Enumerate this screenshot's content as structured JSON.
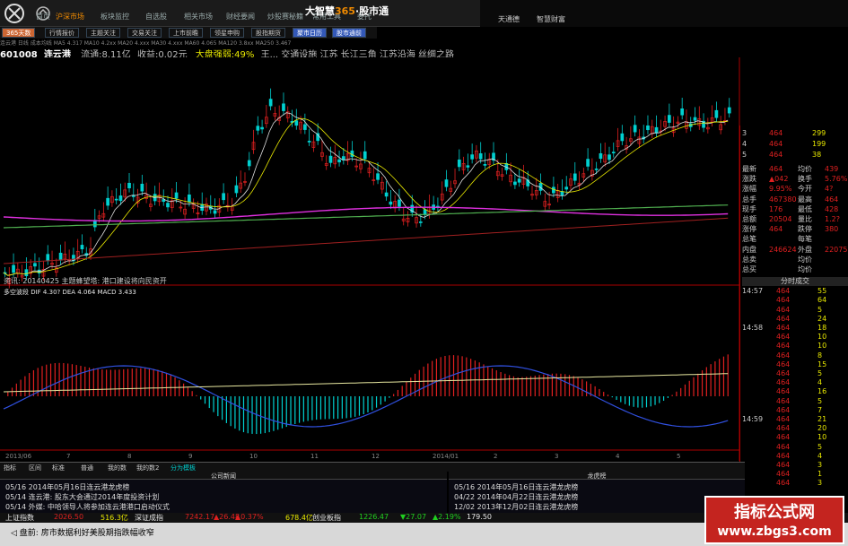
{
  "app": {
    "brand_main": "大智慧",
    "brand_num": "365",
    "brand_sep": "·",
    "brand_sub": "股市通"
  },
  "nav": [
    {
      "label": "首页"
    },
    {
      "label": "沪深市场"
    },
    {
      "label": "板块监控"
    },
    {
      "label": "自选股"
    },
    {
      "label": "相关市场"
    },
    {
      "label": "财经要闻"
    },
    {
      "label": "炒股赛秘籍"
    },
    {
      "label": "常用工具"
    },
    {
      "label": "委托"
    }
  ],
  "right_nav": [
    {
      "label": "天通德"
    },
    {
      "label": "智慧财富"
    }
  ],
  "toolbar": [
    {
      "label": "365天数"
    },
    {
      "label": "行情报价"
    },
    {
      "label": "主题关注"
    },
    {
      "label": "交易关注"
    },
    {
      "label": "上市前瞻"
    },
    {
      "label": "领星申购"
    },
    {
      "label": "股指期货"
    },
    {
      "label": "聚市日历"
    },
    {
      "label": "股市通前"
    }
  ],
  "stock": {
    "code": "601008",
    "name": "连云港",
    "stock_line": "连云港   日线   成本均线   MA5 4.317   MA10 4.2xx   MA20 4.xxx   MA30 4.xxx   MA60 4.065   MA120 3.8xx   MA250 3.467",
    "circ_label": "流通:",
    "circ": "8.11亿",
    "gain_label": "收益",
    "gain": "0.02元",
    "mkt": "大盘强弱:49%",
    "region": "王... 交通设施  江苏  长江三角  江苏沿海  丝绸之路"
  },
  "info_line": "资讯:   20140425  主题蜂望塔: 港口建设将向民资开",
  "macd_line": "多空波段   DIF 4.30?  DEA 4.064  MACD 3.433",
  "dates": [
    "2013/06",
    "7",
    "8",
    "9",
    "10",
    "11",
    "12",
    "2014/01",
    "2",
    "3",
    "4",
    "5"
  ],
  "chart_data": {
    "type": "line",
    "title": "601008 连云港",
    "series": [
      {
        "name": "MA250"
      }
    ],
    "ylim": [
      3.3,
      5.4
    ]
  },
  "order_book": [
    {
      "level": "3",
      "price": "464",
      "vol": "299"
    },
    {
      "level": "4",
      "price": "464",
      "vol": "199"
    },
    {
      "level": "5",
      "price": "464",
      "vol": "38"
    }
  ],
  "quote": [
    {
      "l1": "最新",
      "v1": "464",
      "l2": "均价",
      "v2": "439"
    },
    {
      "l1": "涨跌",
      "v1": "▲042",
      "l2": "换手",
      "v2": "5.76%"
    },
    {
      "l1": "涨幅",
      "v1": "9.95%",
      "l2": "今开",
      "v2": "4?"
    },
    {
      "l1": "总手",
      "v1": "467380",
      "l2": "最高",
      "v2": "464"
    },
    {
      "l1": "现手",
      "v1": "176",
      "l2": "最低",
      "v2": "428"
    },
    {
      "l1": "总额",
      "v1": "20504",
      "l2": "量比",
      "v2": "1.2?"
    },
    {
      "l1": "涨停",
      "v1": "464",
      "l2": "跌停",
      "v2": "380"
    },
    {
      "l1": "总笔",
      "v1": "",
      "l2": "每笔",
      "v2": ""
    },
    {
      "l1": "内盘",
      "v1": "246624",
      "l2": "外盘",
      "v2": "220756"
    },
    {
      "l1": "总卖",
      "v1": "",
      "l2": "均价",
      "v2": ""
    },
    {
      "l1": "总买",
      "v1": "",
      "l2": "均价",
      "v2": ""
    }
  ],
  "trades_header": "分时成交",
  "trades": [
    {
      "t": "14:57",
      "p": "464",
      "v": "55"
    },
    {
      "t": "",
      "p": "464",
      "v": "64"
    },
    {
      "t": "",
      "p": "464",
      "v": "5"
    },
    {
      "t": "",
      "p": "464",
      "v": "24"
    },
    {
      "t": "14:58",
      "p": "464",
      "v": "18"
    },
    {
      "t": "",
      "p": "464",
      "v": "10"
    },
    {
      "t": "",
      "p": "464",
      "v": "10"
    },
    {
      "t": "",
      "p": "464",
      "v": "8"
    },
    {
      "t": "",
      "p": "464",
      "v": "15"
    },
    {
      "t": "",
      "p": "464",
      "v": "5"
    },
    {
      "t": "",
      "p": "464",
      "v": "4"
    },
    {
      "t": "",
      "p": "464",
      "v": "16"
    },
    {
      "t": "",
      "p": "464",
      "v": "5"
    },
    {
      "t": "",
      "p": "464",
      "v": "7"
    },
    {
      "t": "14:59",
      "p": "464",
      "v": "21"
    },
    {
      "t": "",
      "p": "464",
      "v": "20"
    },
    {
      "t": "",
      "p": "464",
      "v": "10"
    },
    {
      "t": "",
      "p": "464",
      "v": "5"
    },
    {
      "t": "",
      "p": "464",
      "v": "4"
    },
    {
      "t": "",
      "p": "464",
      "v": "3"
    },
    {
      "t": "",
      "p": "464",
      "v": "1"
    },
    {
      "t": "",
      "p": "464",
      "v": "3"
    }
  ],
  "bottom_tabs": [
    "指标",
    "区间",
    "标准",
    "普通",
    "我的数",
    "我的数2",
    "我的数",
    "分为模板"
  ],
  "news": {
    "left_header": "公司新闻",
    "left": [
      "05/16  2014年05月16日连云港龙虎榜",
      "05/14  连云港: 股东大会通过2014年度投资计划",
      "05/14  外媒: 中哈领导人将参加连云港港口启动仪式"
    ],
    "right_header": "龙虎榜",
    "right": [
      "05/16  2014年05月16日连云港龙虎榜",
      "04/22  2014年04月22日连云港龙虎榜",
      "12/02  2013年12月02日连云港龙虎榜"
    ]
  },
  "ticker": [
    {
      "text": "上证指数",
      "color": "#e8e8e8"
    },
    {
      "text": "2026.50",
      "color": "#e02020"
    },
    {
      "text": "516.3亿",
      "color": "#e8e800"
    },
    {
      "text": "深证成指",
      "color": "#e8e8e8"
    },
    {
      "text": "7242.17",
      "color": "#e02020"
    },
    {
      "text": "▲26.48",
      "color": "#e02020"
    },
    {
      "text": "▲0.37%",
      "color": "#e02020"
    },
    {
      "text": "678.4亿",
      "color": "#e8e800"
    },
    {
      "text": "创业板指",
      "color": "#e8e8e8"
    },
    {
      "text": "1226.47",
      "color": "#20d020"
    },
    {
      "text": "▼27.07",
      "color": "#20d020"
    },
    {
      "text": "▲2.19%",
      "color": "#20d020"
    },
    {
      "text": "179.50",
      "color": "#e8e8e8"
    }
  ],
  "status": {
    "scroll": "盘前: 房市数据利好美股期指跌幅收窄"
  },
  "watermark": {
    "title": "指标公式网",
    "url": "www.zbgs3.com"
  },
  "colors": {
    "up": "#e02020",
    "down": "#00d0d0",
    "ma_pink": "#e030e0",
    "ma_green": "#50b050",
    "ma_red": "#a02020"
  }
}
